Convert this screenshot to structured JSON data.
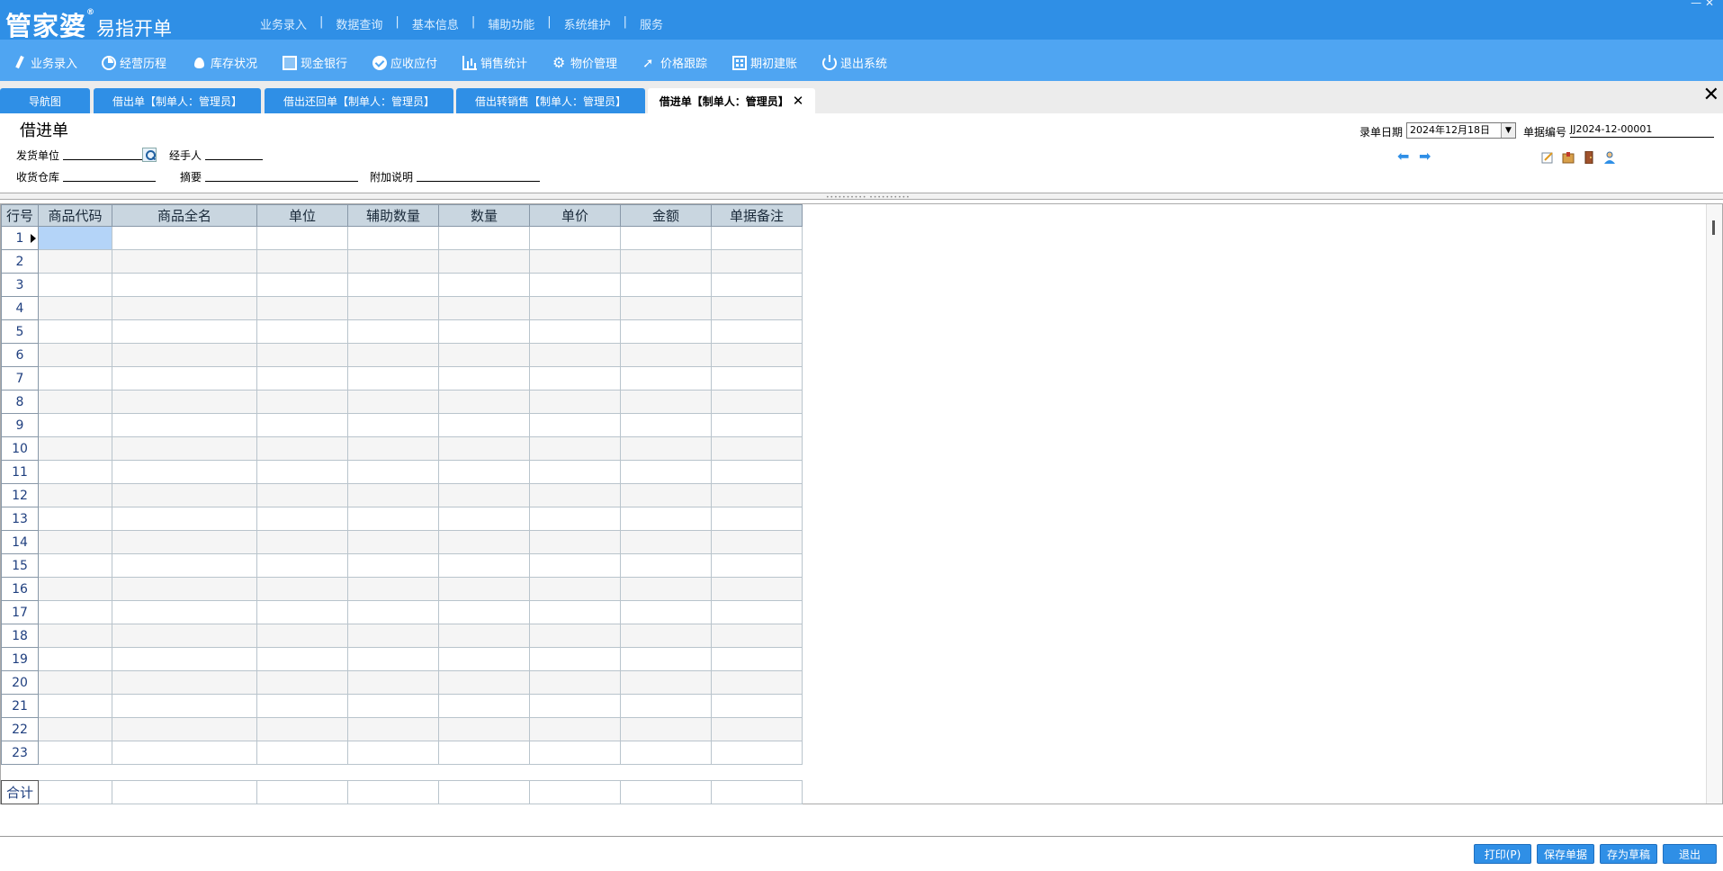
{
  "app": {
    "logo_main": "管家婆",
    "logo_reg": "®",
    "logo_sub": "易指开单"
  },
  "top_menu": [
    "业务录入",
    "数据查询",
    "基本信息",
    "辅助功能",
    "系统维护",
    "服务"
  ],
  "toolbar": [
    {
      "label": "业务录入",
      "icon": "pen-icon"
    },
    {
      "label": "经营历程",
      "icon": "pie-chart-icon"
    },
    {
      "label": "库存状况",
      "icon": "fire-icon"
    },
    {
      "label": "现金银行",
      "icon": "book-icon"
    },
    {
      "label": "应收应付",
      "icon": "check-circle-icon"
    },
    {
      "label": "销售统计",
      "icon": "bar-chart-icon"
    },
    {
      "label": "物价管理",
      "icon": "gear-icon"
    },
    {
      "label": "价格跟踪",
      "icon": "arrow-up-right-icon"
    },
    {
      "label": "期初建账",
      "icon": "calculator-icon"
    },
    {
      "label": "退出系统",
      "icon": "power-icon"
    }
  ],
  "tabs": [
    {
      "label": "导航图",
      "active": false
    },
    {
      "label": "借出单【制单人：管理员】",
      "active": false
    },
    {
      "label": "借出还回单【制单人：管理员】",
      "active": false
    },
    {
      "label": "借出转销售【制单人：管理员】",
      "active": false
    },
    {
      "label": "借进单【制单人：管理员】",
      "active": true
    }
  ],
  "form": {
    "title": "借进单",
    "supplier_label": "发货单位",
    "handler_label": "经手人",
    "warehouse_label": "收货仓库",
    "summary_label": "摘要",
    "note_label": "附加说明",
    "date_label": "录单日期",
    "date_value": "2024年12月18日",
    "docno_label": "单据编号",
    "docno_value": "JJ2024-12-00001"
  },
  "grid": {
    "columns": [
      "行号",
      "商品代码",
      "商品全名",
      "单位",
      "辅助数量",
      "数量",
      "单价",
      "金额",
      "单据备注"
    ],
    "row_count": 23,
    "total_label": "合计"
  },
  "buttons": {
    "print": "打印(P)",
    "save": "保存单据",
    "draft": "存为草稿",
    "exit": "退出"
  },
  "colors": {
    "header_blue": "#2f8fe6",
    "toolbar_blue": "#4fa5f2",
    "grid_header": "#c9d6e0",
    "selected_cell": "#b4d4f8"
  }
}
